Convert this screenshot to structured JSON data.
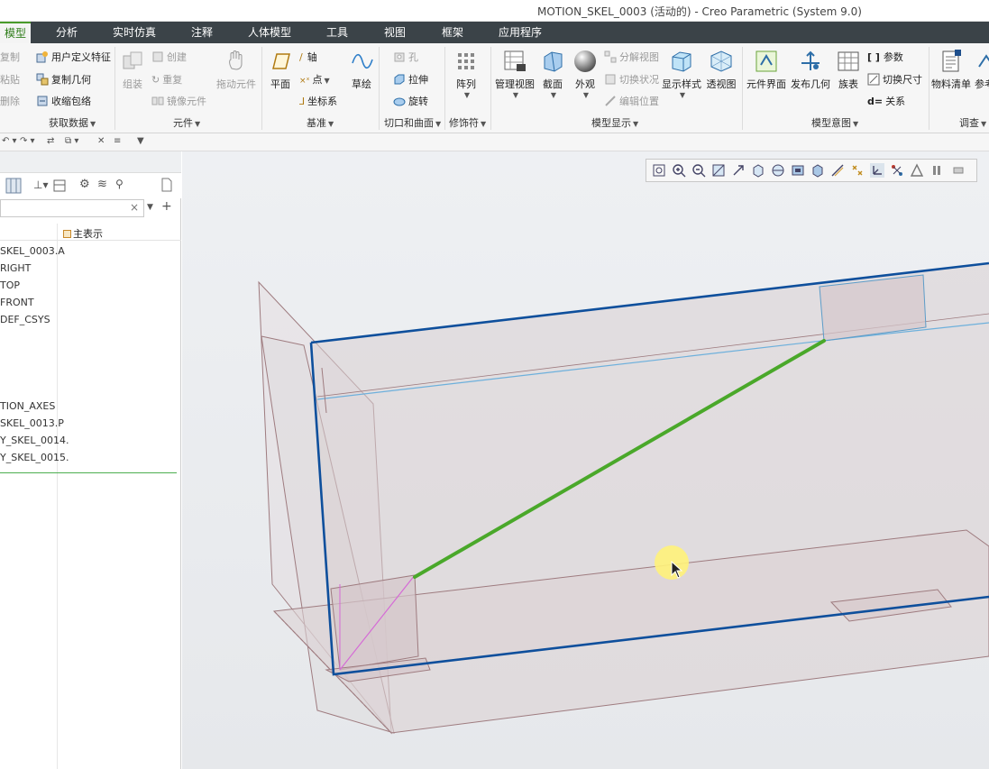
{
  "window": {
    "title": "MOTION_SKEL_0003 (活动的) - Creo Parametric (System 9.0)"
  },
  "tabs": [
    "模型",
    "分析",
    "实时仿真",
    "注释",
    "人体模型",
    "工具",
    "视图",
    "框架",
    "应用程序"
  ],
  "ribbon": {
    "get_data": {
      "items": [
        "复制",
        "粘贴",
        "删除",
        "用户定义特征",
        "复制几何",
        "收缩包络"
      ],
      "group": "获取数据"
    },
    "component": {
      "assemble": "组装",
      "create": "创建",
      "repeat": "重复",
      "mirror": "镜像元件",
      "drag": "拖动元件",
      "group": "元件"
    },
    "datum": {
      "plane": "平面",
      "axis": "轴",
      "point": "点",
      "csys": "坐标系",
      "sketch": "草绘",
      "group": "基准"
    },
    "cut_surface": {
      "hole": "孔",
      "extrude": "拉伸",
      "revolve": "旋转",
      "group": "切口和曲面"
    },
    "modifiers": {
      "pattern": "阵列",
      "group": "修饰符"
    },
    "model_display": {
      "manage_views": "管理视图",
      "section": "截面",
      "appearance": "外观",
      "explode": "分解视图",
      "toggle_status": "切换状况",
      "edit_position": "编辑位置",
      "display_style": "显示样式",
      "perspective": "透视图",
      "group": "模型显示"
    },
    "model_intent": {
      "component_interface": "元件界面",
      "publish_geometry": "发布几何",
      "family_table": "族表",
      "parameters": "参数",
      "switch_dims": "切换尺寸",
      "relations": "关系",
      "group": "模型意图"
    },
    "investigate": {
      "bom": "物料清单",
      "ref": "参考",
      "group": "调查"
    }
  },
  "model_tree": {
    "column_header": "主表示",
    "items": [
      "SKEL_0003.A",
      "RIGHT",
      "TOP",
      "FRONT",
      "DEF_CSYS",
      "TION_AXES",
      "SKEL_0013.P",
      "Y_SKEL_0014.",
      "Y_SKEL_0015."
    ]
  },
  "colors": {
    "tab_bar": "#3b4348",
    "active_tab_text": "#2f7d1a",
    "selection_edge": "#0e4f9c",
    "highlight_line": "#4aa82a"
  }
}
